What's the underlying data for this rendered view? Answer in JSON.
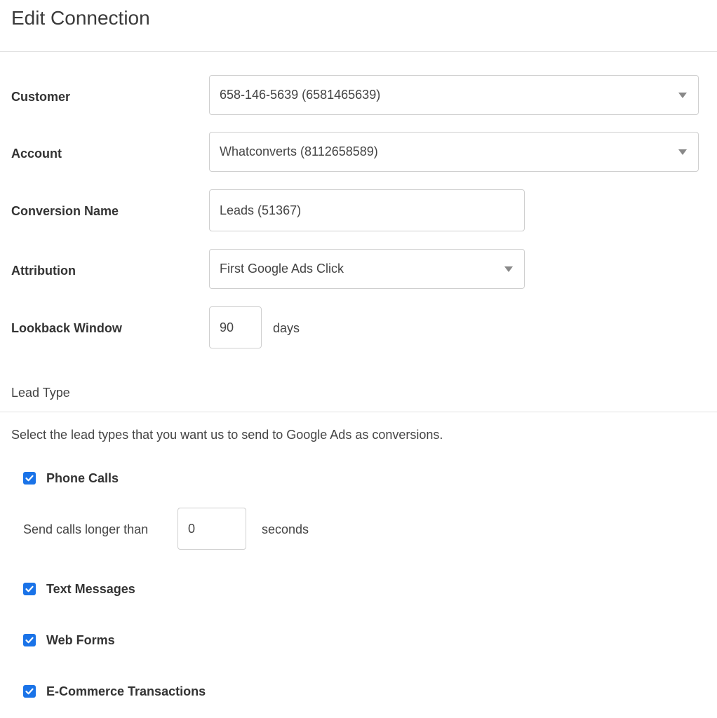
{
  "page": {
    "title": "Edit Connection"
  },
  "form": {
    "customer": {
      "label": "Customer",
      "value": "658-146-5639 (6581465639)"
    },
    "account": {
      "label": "Account",
      "value": "Whatconverts (8112658589)"
    },
    "conversion_name": {
      "label": "Conversion Name",
      "value": "Leads (51367)"
    },
    "attribution": {
      "label": "Attribution",
      "value": "First Google Ads Click"
    },
    "lookback_window": {
      "label": "Lookback Window",
      "value": "90",
      "suffix": "days"
    }
  },
  "lead_type": {
    "heading": "Lead Type",
    "description": "Select the lead types that you want us to send to Google Ads as conversions.",
    "phone_calls": {
      "label": "Phone Calls",
      "checked": true,
      "min_duration_label": "Send calls longer than",
      "min_duration_value": "0",
      "min_duration_suffix": "seconds"
    },
    "text_messages": {
      "label": "Text Messages",
      "checked": true
    },
    "web_forms": {
      "label": "Web Forms",
      "checked": true
    },
    "ecommerce": {
      "label": "E-Commerce Transactions",
      "checked": true
    }
  },
  "colors": {
    "checkbox_accent": "#1a73e8",
    "border": "#cfcfcf",
    "divider": "#e2e2e2"
  }
}
